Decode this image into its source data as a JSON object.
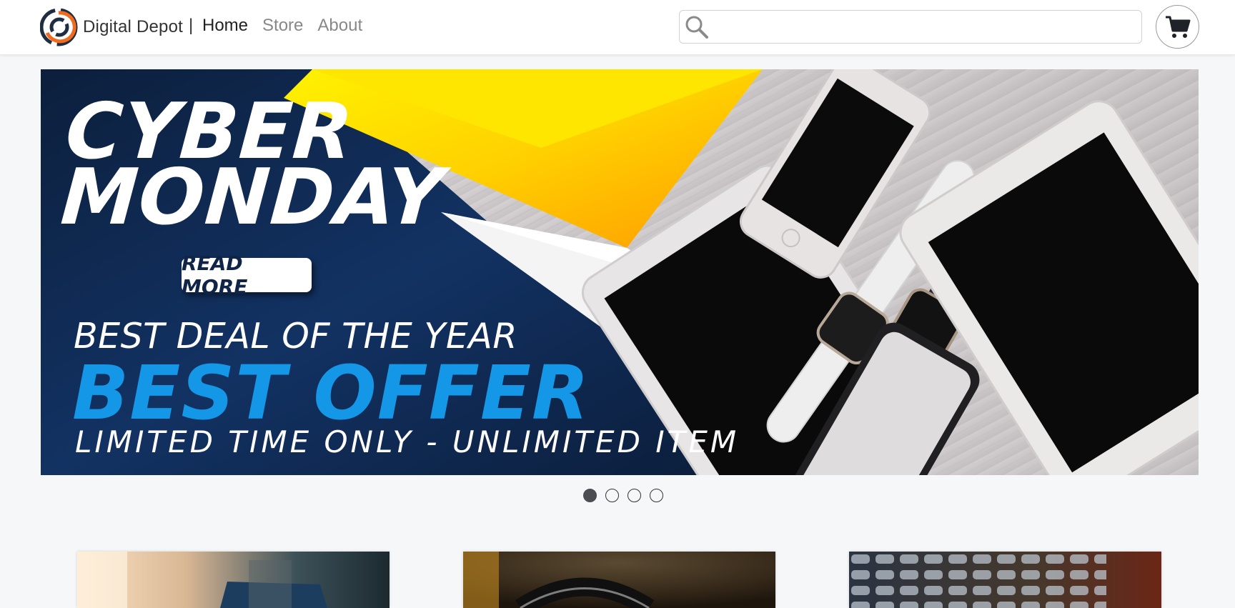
{
  "brand": {
    "name": "Digital Depot",
    "logo_icon": "ring-logo-icon",
    "accent": "#f26b1d",
    "dark": "#1e2d40"
  },
  "nav": {
    "separator": "|",
    "links": [
      {
        "label": "Home",
        "active": true
      },
      {
        "label": "Store",
        "active": false
      },
      {
        "label": "About",
        "active": false
      }
    ]
  },
  "search": {
    "placeholder": "",
    "value": "",
    "icon": "search-icon"
  },
  "cart": {
    "icon": "shopping-cart-icon"
  },
  "hero": {
    "title_line1": "CYBER",
    "title_line2": "MONDAY",
    "button_label": "READ MORE",
    "deal_text": "BEST DEAL OF THE YEAR",
    "offer_text": "BEST OFFER",
    "limited_text": "LIMITED TIME ONLY - UNLIMITED ITEM",
    "colors": {
      "navy": "#0f2447",
      "yellow": "#ffd200",
      "offer_blue": "#1397e6"
    }
  },
  "carousel": {
    "slides": 4,
    "active_index": 0
  },
  "product_cards": [
    {
      "image": "laptop-photo"
    },
    {
      "image": "headphones-photo"
    },
    {
      "image": "keyboard-photo"
    }
  ]
}
